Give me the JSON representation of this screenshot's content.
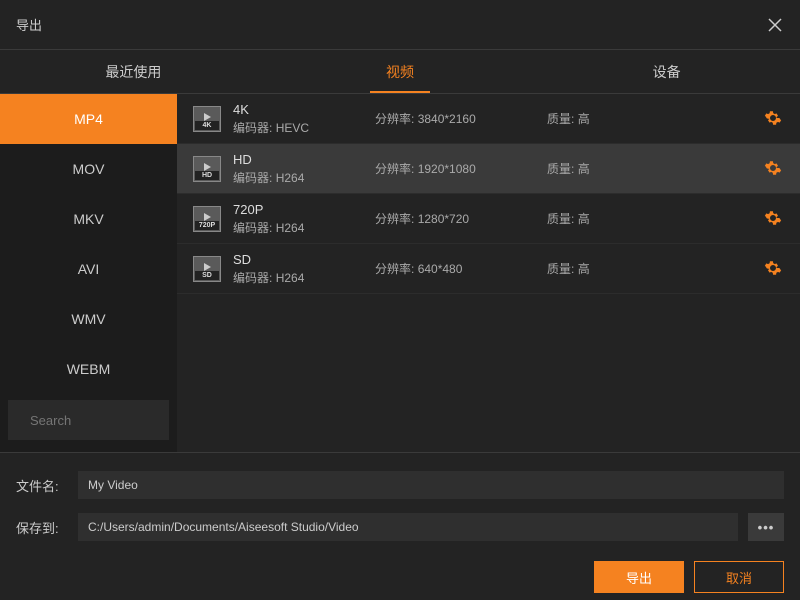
{
  "title": "导出",
  "tabs": {
    "recent": "最近使用",
    "video": "视频",
    "device": "设备"
  },
  "formats": [
    "MP4",
    "MOV",
    "MKV",
    "AVI",
    "WMV",
    "WEBM"
  ],
  "search_placeholder": "Search",
  "encoder_label": "编码器:",
  "res_label": "分辨率:",
  "quality_label": "质量:",
  "presets": [
    {
      "name": "4K",
      "badge": "4K",
      "encoder": "HEVC",
      "res": "3840*2160",
      "quality": "高"
    },
    {
      "name": "HD",
      "badge": "HD",
      "encoder": "H264",
      "res": "1920*1080",
      "quality": "高"
    },
    {
      "name": "720P",
      "badge": "720P",
      "encoder": "H264",
      "res": "1280*720",
      "quality": "高"
    },
    {
      "name": "SD",
      "badge": "SD",
      "encoder": "H264",
      "res": "640*480",
      "quality": "高"
    }
  ],
  "filename_label": "文件名:",
  "filename_value": "My Video",
  "saveto_label": "保存到:",
  "saveto_value": "C:/Users/admin/Documents/Aiseesoft Studio/Video",
  "browse_label": "•••",
  "export_btn": "导出",
  "cancel_btn": "取消"
}
